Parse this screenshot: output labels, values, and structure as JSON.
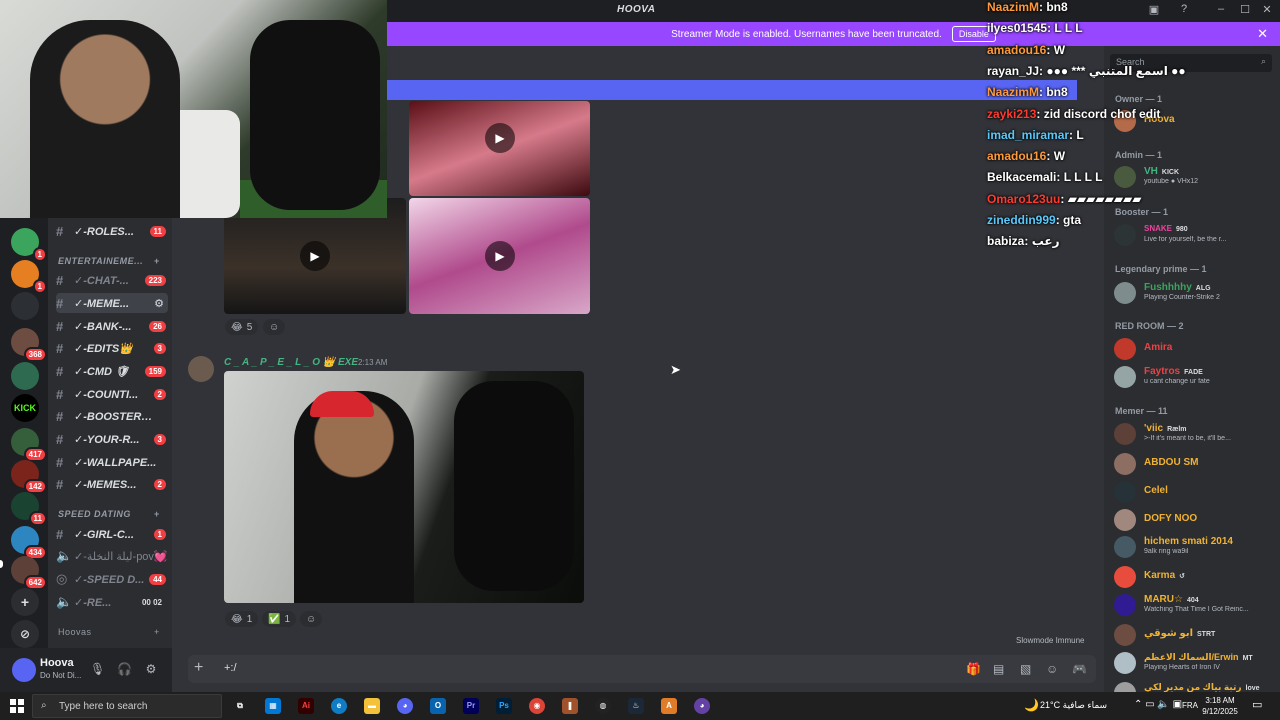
{
  "window": {
    "title": "HOOVA"
  },
  "streamer_banner": {
    "text": "Streamer Mode is enabled. Usernames have been truncated.",
    "button": "Disable"
  },
  "twitch_chat": [
    {
      "user": "NaazimM",
      "msg": ": bn8",
      "color": "#ff9a3c"
    },
    {
      "user": "ilyes01545",
      "msg": ": L L L",
      "color": "#ffffff"
    },
    {
      "user": "amadou16",
      "msg": ": W",
      "color": "#ff9a3c"
    },
    {
      "user": "rayan_JJ",
      "msg": ": ●●● *** اسمع المتنبي ●●",
      "color": "#ffffff"
    },
    {
      "user": "NaazimM",
      "msg": ": bn8",
      "color": "#ff9a3c"
    },
    {
      "user": "zayki213",
      "msg": ": zid discord chof edit",
      "color": "#ff3b30"
    },
    {
      "user": "imad_miramar",
      "msg": ": L",
      "color": "#5ac8fa"
    },
    {
      "user": "amadou16",
      "msg": ": W",
      "color": "#ff9a3c"
    },
    {
      "user": "Belkacemali",
      "msg": ": L L L L",
      "color": "#ffffff"
    },
    {
      "user": "Omaro123uu",
      "msg": ": ▰▰▰▰▰▰▰▰",
      "color": "#ff3b30"
    },
    {
      "user": "zineddin999",
      "msg": ": gta",
      "color": "#5ac8fa"
    },
    {
      "user": "babiza",
      "msg": ": رعب",
      "color": "#ffffff"
    }
  ],
  "server_badges": [
    "1",
    "1",
    "368",
    "KICK",
    "417",
    "142",
    "11",
    "434",
    "642"
  ],
  "channels": [
    {
      "label": "✓-ROLES...",
      "count": "11"
    },
    {
      "category": "ENTERTAINEME..."
    },
    {
      "label": "✓-CHAT-...",
      "count": "223",
      "muted": true
    },
    {
      "label": "✓-MEME...",
      "count": ""
    },
    {
      "label": "✓-BANK-...",
      "count": "26"
    },
    {
      "label": "✓-EDITS👑",
      "count": "3"
    },
    {
      "label": "✓-CMD 🛡",
      "count": "159"
    },
    {
      "label": "✓-COUNTI...",
      "count": "2"
    },
    {
      "label": "✓-BOOSTER💜",
      "count": ""
    },
    {
      "label": "✓-YOUR-R...",
      "count": "3"
    },
    {
      "label": "✓-WALLPAPE...",
      "count": ""
    },
    {
      "label": "✓-MEMES...",
      "count": "2"
    },
    {
      "category": "SPEED DATING"
    },
    {
      "label": "✓-GIRL-C...",
      "count": "1"
    },
    {
      "label": "✓-ليلة النخلة-pov💓",
      "count": "",
      "voice": true
    },
    {
      "label": "✓-SPEED D...",
      "count": "44",
      "voice": true
    },
    {
      "label": "✓-RE...",
      "count": "00 02",
      "voice": true
    },
    {
      "category": "Hoovas"
    }
  ],
  "message": {
    "author": "C _ A _ P _ E _ L _ O 👑 EXE",
    "time": "2:13 AM",
    "reactions_top": [
      {
        "emoji": "😂",
        "count": "5"
      }
    ],
    "reactions_bottom": [
      {
        "emoji": "😂",
        "count": "1"
      },
      {
        "emoji": "✅",
        "count": "1"
      }
    ]
  },
  "user_panel": {
    "name": "Hoova",
    "status": "Do Not Di..."
  },
  "composer": {
    "text": "+:/"
  },
  "slowmode": "Slowmode Immune",
  "members": {
    "search_placeholder": "Search",
    "sections": [
      {
        "title": "Owner — 1",
        "items": [
          {
            "name": "Hoova",
            "color": "#f0b232",
            "sub": ""
          }
        ]
      },
      {
        "title": "Admin — 1",
        "items": [
          {
            "name": "VH",
            "color": "#43b581",
            "tag": "KICK",
            "sub": "youtube ● VHx12"
          }
        ]
      },
      {
        "title": "Booster — 1",
        "items": [
          {
            "name": "SNAKE",
            "color": "#eb459e",
            "tag": "980",
            "sub": "Live for yourself, be the r..."
          }
        ]
      },
      {
        "title": "Legendary prime — 1",
        "items": [
          {
            "name": "Fushhhhy",
            "color": "#3ba55d",
            "tag": "ALG",
            "sub": "Playing Counter-Strike 2"
          }
        ]
      },
      {
        "title": "RED ROOM — 2",
        "items": [
          {
            "name": "Amira",
            "color": "#ed4245",
            "sub": ""
          },
          {
            "name": "Faytros",
            "color": "#ed4245",
            "tag": "FADE",
            "sub": "u cant change ur fate"
          }
        ]
      },
      {
        "title": "Memer — 11",
        "items": [
          {
            "name": "'viic",
            "color": "#f0b232",
            "tag": "Rælm",
            "sub": ">-If it's meant to be, it'll be..."
          },
          {
            "name": "ABDOU SM",
            "color": "#f0b232",
            "sub": ""
          },
          {
            "name": "Celel",
            "color": "#f0b232",
            "sub": ""
          },
          {
            "name": "DOFY NOO",
            "color": "#f0b232",
            "sub": ""
          },
          {
            "name": "hichem smati 2014",
            "color": "#f0b232",
            "sub": "9alk ring wa9il"
          },
          {
            "name": "Karma",
            "color": "#f0b232",
            "tag": "↺",
            "sub": ""
          },
          {
            "name": "MARU☆",
            "color": "#f0b232",
            "tag": "404",
            "sub": "Watching That Time I Got Reinc..."
          },
          {
            "name": "ابو شوقي",
            "color": "#f0b232",
            "tag": "STRT",
            "sub": ""
          },
          {
            "name": "السماك الاعظم/Erwin",
            "color": "#f0b232",
            "tag": "MT",
            "sub": "Playing Hearts of Iron IV"
          },
          {
            "name": "رتبة بياك من مدير لكي",
            "color": "#f0b232",
            "tag": "love",
            "sub": ""
          }
        ]
      }
    ]
  },
  "taskbar": {
    "search_placeholder": "Type here to search",
    "weather": "21°C سماء صافية",
    "lang": "FRA",
    "time": "3:18 AM",
    "date": "9/12/2025"
  }
}
